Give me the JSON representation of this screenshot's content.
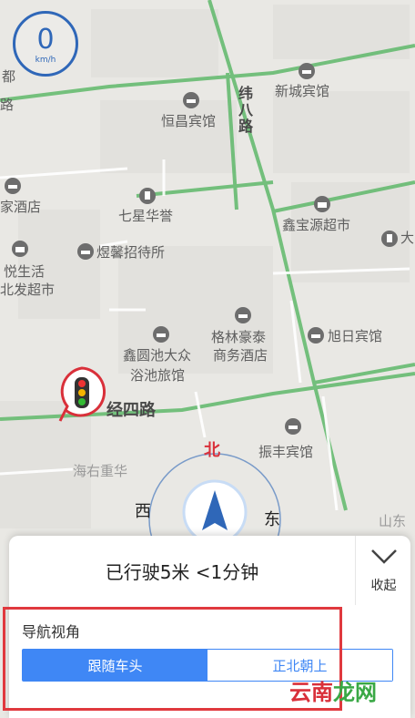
{
  "speedometer": {
    "value": "0",
    "unit": "km/h"
  },
  "map": {
    "pois": [
      {
        "name": "新城宾馆"
      },
      {
        "name": "恒昌宾馆"
      },
      {
        "name": "七星华誉"
      },
      {
        "name": "鑫宝源超市"
      },
      {
        "name": "煜馨招待所"
      },
      {
        "name": "格林豪泰"
      },
      {
        "name": "商务酒店"
      },
      {
        "name": "旭日宾馆"
      },
      {
        "name": "鑫圆池大众"
      },
      {
        "name": "浴池旅馆"
      },
      {
        "name": "振丰宾馆"
      },
      {
        "name": "家酒店"
      },
      {
        "name": "悦生活"
      },
      {
        "name": "北发超市"
      },
      {
        "name": "都"
      },
      {
        "name": "路"
      },
      {
        "name": "大"
      }
    ],
    "roads": {
      "road_v": "纬八路",
      "road_h": "经四路"
    },
    "grey_labels": {
      "left": "海右重华",
      "right": "山东"
    }
  },
  "compass": {
    "north": "北",
    "west": "西",
    "east": "东"
  },
  "panel": {
    "trip_status": "已行驶5米 <1分钟",
    "collapse_label": "收起",
    "view_title": "导航视角",
    "options": {
      "follow": "跟随车头",
      "north_up": "正北朝上"
    }
  },
  "watermark": {
    "part1": "云南",
    "part2": "龙网"
  },
  "colors": {
    "accent": "#3f87f5",
    "highlight": "#e0393e",
    "road": "#49b35c",
    "speed_ring": "#2f67b8"
  }
}
